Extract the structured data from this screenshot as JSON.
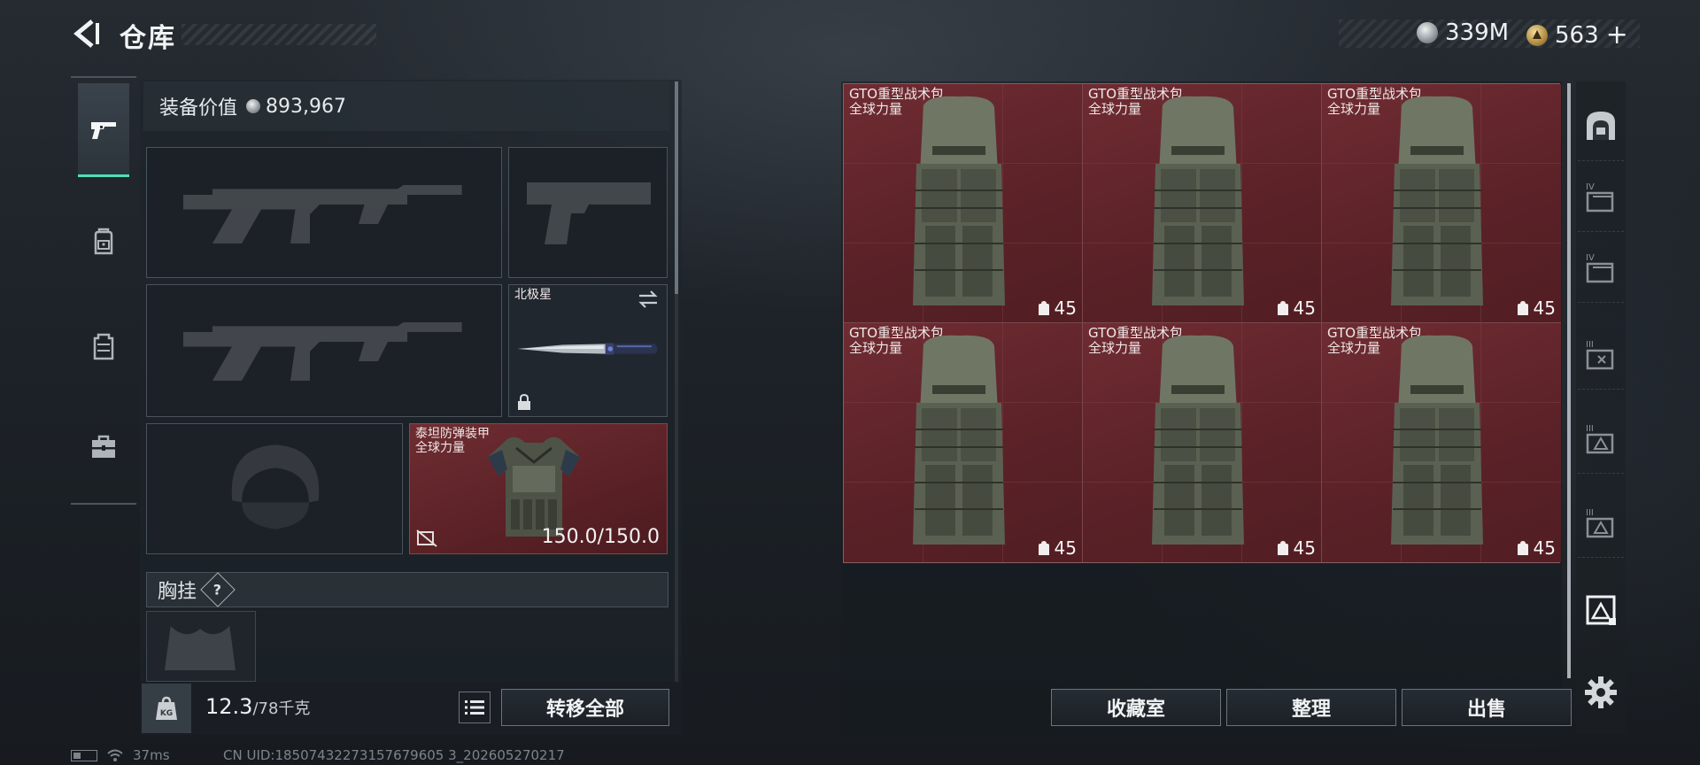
{
  "header": {
    "title": "仓库",
    "silver_currency": "339M",
    "gold_currency": "563",
    "add_label": "+"
  },
  "left_rail": {
    "categories": [
      {
        "icon": "gun-icon",
        "active": true
      },
      {
        "icon": "backpack-icon",
        "active": false
      },
      {
        "icon": "chest-rig-icon",
        "active": false
      },
      {
        "icon": "toolbox-icon",
        "active": false
      }
    ]
  },
  "loadout": {
    "equipment_value_label": "装备价值",
    "equipment_value": "893,967",
    "melee": {
      "name": "北极星"
    },
    "armor": {
      "name": "泰坦防弹装甲",
      "sub": "全球力量",
      "durability": "150.0/150.0"
    },
    "chest_rig_label": "胸挂",
    "help_label": "?",
    "weight": "12.3",
    "weight_capacity": "/78千克",
    "weight_badge": "KG",
    "transfer_all_label": "转移全部"
  },
  "storage": {
    "items": [
      {
        "name": "GTO重型战术包",
        "sub": "全球力量",
        "capacity": "45"
      },
      {
        "name": "GTO重型战术包",
        "sub": "全球力量",
        "capacity": "45"
      },
      {
        "name": "GTO重型战术包",
        "sub": "全球力量",
        "capacity": "45"
      },
      {
        "name": "GTO重型战术包",
        "sub": "全球力量",
        "capacity": "45"
      },
      {
        "name": "GTO重型战术包",
        "sub": "全球力量",
        "capacity": "45"
      },
      {
        "name": "GTO重型战术包",
        "sub": "全球力量",
        "capacity": "45"
      }
    ],
    "collection_label": "收藏室",
    "organize_label": "整理",
    "sell_label": "出售"
  },
  "page_tabs": [
    {
      "icon": "vault-icon",
      "active": false
    },
    {
      "icon": "storage-page-IV-a-icon",
      "active": false
    },
    {
      "icon": "storage-page-IV-b-icon",
      "active": false
    },
    {
      "icon": "storage-page-III-a-icon",
      "active": false
    },
    {
      "icon": "storage-page-III-b-icon",
      "active": false
    },
    {
      "icon": "storage-page-III-c-icon",
      "active": false
    },
    {
      "icon": "storage-page-current-icon",
      "active": true
    }
  ],
  "status": {
    "ping": "37ms",
    "uid": "CN UID:18507432273157679605 3_202605270217"
  },
  "colors": {
    "accent": "#4ee1b3",
    "item_red": "#5a2228",
    "panel": "#1d2228"
  }
}
